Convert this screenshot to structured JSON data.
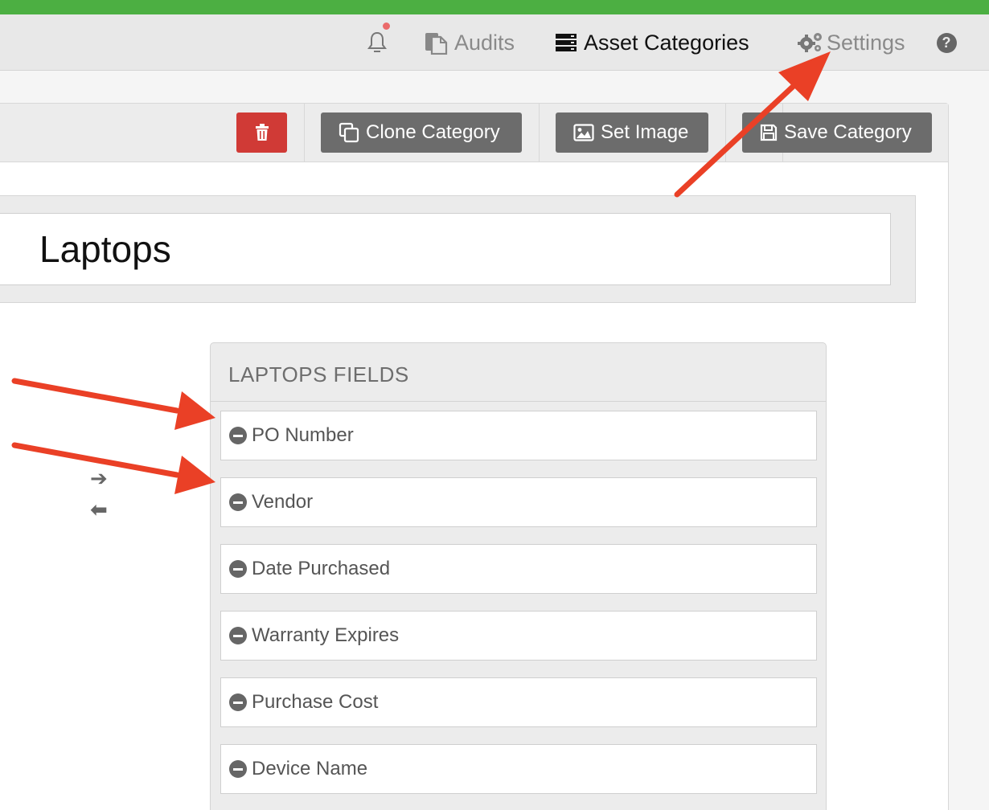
{
  "colors": {
    "accent_green": "#4caf42",
    "annotation_red": "#ea4026",
    "danger": "#d03a36",
    "button_gray": "#6c6c6c"
  },
  "nav": {
    "notifications_icon": "bell-icon",
    "audits_label": "Audits",
    "asset_categories_label": "Asset Categories",
    "settings_label": "Settings",
    "help_label": "?"
  },
  "toolbar": {
    "clone_label": "Clone Category",
    "set_image_label": "Set Image",
    "save_label": "Save Category"
  },
  "category": {
    "name": "Laptops"
  },
  "fields_panel": {
    "title": "LAPTOPS FIELDS",
    "fields": [
      {
        "label": "PO Number"
      },
      {
        "label": "Vendor"
      },
      {
        "label": "Date Purchased"
      },
      {
        "label": "Warranty Expires"
      },
      {
        "label": "Purchase Cost"
      },
      {
        "label": "Device Name"
      }
    ]
  },
  "transfer": {
    "right_arrow": "➔",
    "left_arrow": "⬅"
  }
}
